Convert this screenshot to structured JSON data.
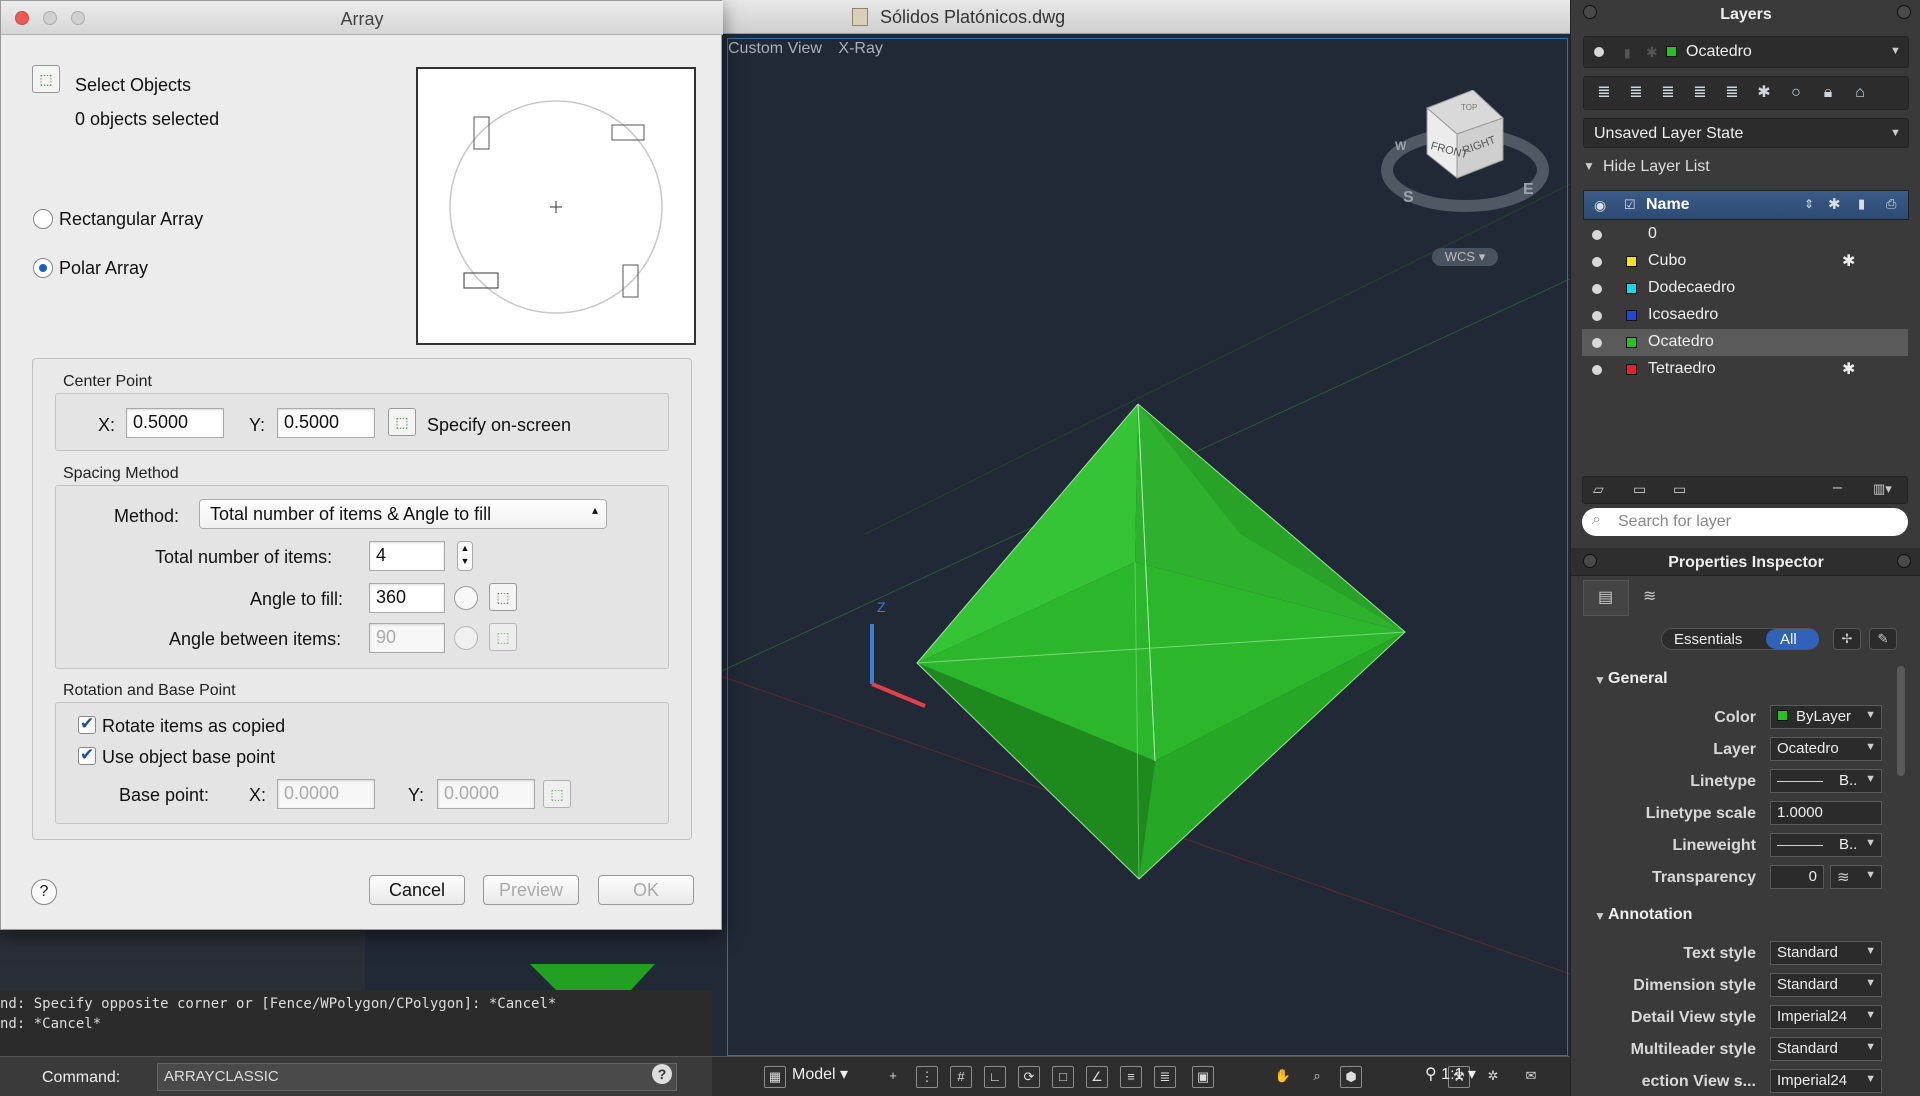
{
  "window": {
    "doc_title": "Sólidos Platónicos.dwg"
  },
  "viewport": {
    "labels": [
      "Custom View",
      "X-Ray"
    ],
    "viewcube": {
      "top": "TOP",
      "front": "FRONT",
      "right": "RIGHT",
      "compass_s": "S",
      "compass_e": "E",
      "compass_w": "W",
      "wcs": "WCS"
    }
  },
  "dialog": {
    "title": "Array",
    "select_objects": "Select Objects",
    "objects_selected": "0 objects selected",
    "rectangular": "Rectangular Array",
    "polar": "Polar Array",
    "polar_selected": true,
    "center_point": {
      "heading": "Center Point",
      "x_label": "X:",
      "x": "0.5000",
      "y_label": "Y:",
      "y": "0.5000",
      "specify": "Specify on-screen"
    },
    "spacing": {
      "heading": "Spacing Method",
      "method_label": "Method:",
      "method_value": "Total number of items & Angle to fill",
      "total_label": "Total number of items:",
      "total": "4",
      "angle_fill_label": "Angle to fill:",
      "angle_fill": "360",
      "angle_between_label": "Angle between items:",
      "angle_between": "90"
    },
    "rotation": {
      "heading": "Rotation and Base Point",
      "rotate_label": "Rotate items as copied",
      "rotate": true,
      "base_label": "Use object base point",
      "base": true,
      "bp_label": "Base point:",
      "bx_label": "X:",
      "bx": "0.0000",
      "by_label": "Y:",
      "by": "0.0000"
    },
    "help": "?",
    "cancel": "Cancel",
    "preview": "Preview",
    "ok": "OK"
  },
  "command": {
    "history": [
      "nd: Specify opposite corner or [Fence/WPolygon/CPolygon]: *Cancel*",
      "nd: *Cancel*"
    ],
    "label": "Command:",
    "value": "ARRAYCLASSIC",
    "help": "?"
  },
  "statusbar": {
    "model": "Model",
    "scale": "1:1"
  },
  "layers": {
    "title": "Layers",
    "current": "Ocatedro",
    "current_color": "#22c322",
    "state": "Unsaved Layer State",
    "hide_list": "Hide Layer List",
    "name_header": "Name",
    "items": [
      {
        "name": "0",
        "color": "",
        "sun": ""
      },
      {
        "name": "Cubo",
        "color": "#f2e21a",
        "sun": "✱"
      },
      {
        "name": "Dodecaedro",
        "color": "#1ed4e8",
        "sun": ""
      },
      {
        "name": "Icosaedro",
        "color": "#2244e0",
        "sun": ""
      },
      {
        "name": "Ocatedro",
        "color": "#22c322",
        "sun": ""
      },
      {
        "name": "Tetraedro",
        "color": "#e02424",
        "sun": "✱"
      }
    ],
    "search_placeholder": "Search for layer"
  },
  "props": {
    "title": "Properties Inspector",
    "tab_essentials": "Essentials",
    "tab_all": "All",
    "general": "General",
    "annotation": "Annotation",
    "rows": [
      {
        "label": "Color",
        "value": "ByLayer"
      },
      {
        "label": "Layer",
        "value": "Ocatedro"
      },
      {
        "label": "Linetype",
        "value": "B.."
      },
      {
        "label": "Linetype scale",
        "value": "1.0000"
      },
      {
        "label": "Lineweight",
        "value": "B.."
      },
      {
        "label": "Transparency",
        "value": "0"
      }
    ],
    "ann_rows": [
      {
        "label": "Text style",
        "value": "Standard"
      },
      {
        "label": "Dimension style",
        "value": "Standard"
      },
      {
        "label": "Detail View style",
        "value": "Imperial24"
      },
      {
        "label": "Multileader style",
        "value": "Standard"
      },
      {
        "label": "ection View s...",
        "value": "Imperial24"
      }
    ]
  }
}
